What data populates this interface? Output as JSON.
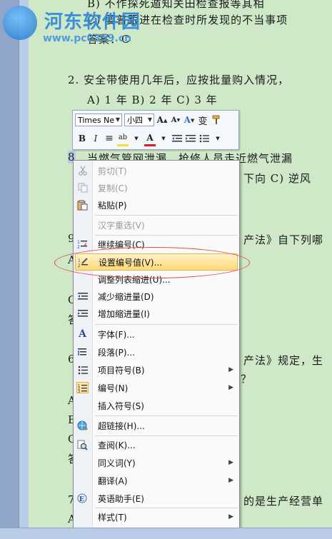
{
  "watermark": {
    "title": "河东软件园",
    "url": "www.pc0359.cn"
  },
  "document": {
    "line_top": "B) 不作探死遁知关田检查报等其相",
    "line_c": "C) 要普跟进在检查时所发现的不当事项",
    "line_answer": "答案：C",
    "q2": "2.  安全带使用几年后，应按批量购入情况，",
    "q2_opts": "A) 1 年        B) 2 年         C) 3 年",
    "q8_num": "8",
    "q8_text": "当燃气管网泄漏，抢修人员走近燃气泄漏",
    "q8_opts": "下向     C) 逆风",
    "q9_num": "9",
    "q9_text": "产法》自下列哪",
    "left_a": "A",
    "left_c": "C",
    "left_da": "答",
    "q6_num": "6",
    "q6_text": "产法》规定，生",
    "q6_end": "？",
    "left_a2": "A",
    "left_b2": "B",
    "left_c2": "C",
    "left_da2": "答",
    "q7_num": "7",
    "q7_text": "的是生产经营单",
    "left_a3": "A"
  },
  "mini_toolbar": {
    "font_name": "Times Ne",
    "font_size": "小四",
    "grow_font": "A",
    "shrink_font": "A",
    "styles": "A",
    "phonetic": "变",
    "bold": "B",
    "italic": "I",
    "center": "≡",
    "highlight": "ab",
    "font_color": "A"
  },
  "context_menu": {
    "items": [
      {
        "label": "剪切(T)",
        "icon": "scissors-icon",
        "disabled": true
      },
      {
        "label": "复制(C)",
        "icon": "copy-icon",
        "disabled": true
      },
      {
        "label": "粘贴(P)",
        "icon": "paste-icon",
        "disabled": false
      },
      {
        "label": "汉字重选(V)",
        "icon": "",
        "disabled": true
      },
      {
        "label": "继续编号(C)",
        "icon": "continue-numbering-icon",
        "disabled": false
      },
      {
        "label": "设置编号值(V)...",
        "icon": "set-numbering-value-icon",
        "disabled": false
      },
      {
        "label": "调整列表缩进(U)...",
        "icon": "",
        "disabled": false
      },
      {
        "label": "减少缩进量(D)",
        "icon": "decrease-indent-icon",
        "disabled": false
      },
      {
        "label": "增加缩进量(I)",
        "icon": "increase-indent-icon",
        "disabled": false
      },
      {
        "label": "字体(F)...",
        "icon": "font-icon",
        "disabled": false
      },
      {
        "label": "段落(P)...",
        "icon": "paragraph-icon",
        "disabled": false
      },
      {
        "label": "项目符号(B)",
        "icon": "bullets-icon",
        "disabled": false
      },
      {
        "label": "编号(N)",
        "icon": "numbering-icon",
        "disabled": false
      },
      {
        "label": "插入符号(S)",
        "icon": "",
        "disabled": false
      },
      {
        "label": "超链接(H)...",
        "icon": "hyperlink-icon",
        "disabled": false
      },
      {
        "label": "查阅(K)...",
        "icon": "lookup-icon",
        "disabled": false
      },
      {
        "label": "同义词(Y)",
        "icon": "",
        "disabled": false
      },
      {
        "label": "翻译(A)",
        "icon": "",
        "disabled": false
      },
      {
        "label": "英语助手(E)",
        "icon": "english-assistant-icon",
        "disabled": false
      },
      {
        "label": "样式(T)",
        "icon": "",
        "disabled": false
      }
    ]
  }
}
